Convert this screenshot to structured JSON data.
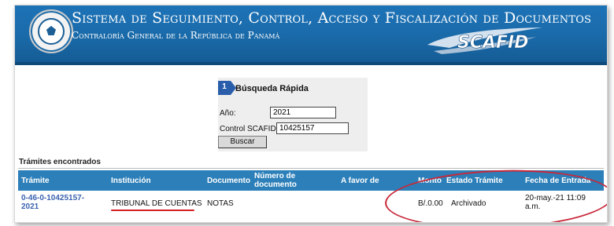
{
  "header": {
    "title": "Sistema de Seguimiento, Control, Acceso y Fiscalización de Documentos",
    "subtitle": "Contraloría General de la República de Panamá",
    "logo_text": "SCAFID"
  },
  "search": {
    "step_number": "1",
    "title": "Búsqueda Rápida",
    "year_label": "Año:",
    "year_value": "2021",
    "control_label": "Control SCAFID:",
    "control_value": "10425157",
    "button_label": "Buscar"
  },
  "results": {
    "section_title": "Trámites encontrados",
    "columns": [
      "Trámite",
      "Institución",
      "Documento",
      "Número de documento",
      "A favor de",
      "Monto",
      "Estado Trámite",
      "Fecha de Entrada"
    ],
    "rows": [
      {
        "tramite": "0-46-0-10425157-2021",
        "institucion": "TRIBUNAL DE CUENTAS",
        "documento": "NOTAS",
        "numero_documento": "",
        "a_favor_de": "",
        "monto": "B/.0.00",
        "estado": "Archivado",
        "fecha_entrada": "20-may.-21 11:09 a.m."
      }
    ]
  },
  "colors": {
    "banner": "#1a6aa9",
    "table_header": "#2c7fb8",
    "link": "#3b63b0",
    "annotation": "#c8283a"
  }
}
